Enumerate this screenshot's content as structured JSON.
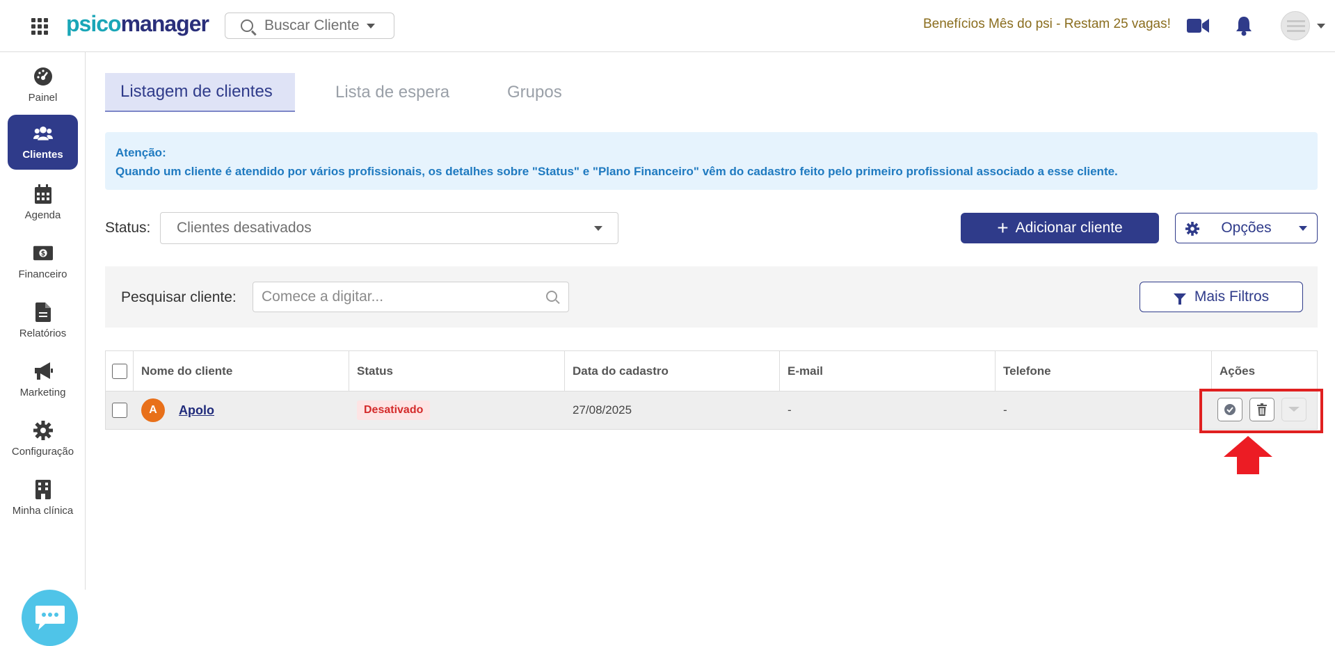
{
  "header": {
    "logo_part1": "psico",
    "logo_part2": "manager",
    "search_label": "Buscar Cliente",
    "promo_text": "Benefícios Mês do psi - Restam 25 vagas!"
  },
  "sidebar": {
    "items": [
      {
        "label": "Painel",
        "icon": "dashboard-icon"
      },
      {
        "label": "Clientes",
        "icon": "users-icon"
      },
      {
        "label": "Agenda",
        "icon": "calendar-icon"
      },
      {
        "label": "Financeiro",
        "icon": "money-icon"
      },
      {
        "label": "Relatórios",
        "icon": "document-icon"
      },
      {
        "label": "Marketing",
        "icon": "megaphone-icon"
      },
      {
        "label": "Configuração",
        "icon": "gear-icon"
      },
      {
        "label": "Minha clínica",
        "icon": "building-icon"
      }
    ],
    "active_index": 1
  },
  "tabs": [
    {
      "label": "Listagem de clientes"
    },
    {
      "label": "Lista de espera"
    },
    {
      "label": "Grupos"
    }
  ],
  "alert": {
    "title": "Atenção:",
    "message": "Quando um cliente é atendido por vários profissionais, os detalhes sobre \"Status\" e \"Plano Financeiro\" vêm do cadastro feito pelo primeiro profissional associado a esse cliente."
  },
  "status_filter": {
    "label": "Status:",
    "value": "Clientes desativados"
  },
  "buttons": {
    "add_client": "Adicionar cliente",
    "options": "Opções",
    "more_filters": "Mais Filtros"
  },
  "search": {
    "label": "Pesquisar cliente:",
    "placeholder": "Comece a digitar..."
  },
  "table": {
    "columns": [
      "Nome do cliente",
      "Status",
      "Data do cadastro",
      "E-mail",
      "Telefone",
      "Ações"
    ],
    "rows": [
      {
        "initial": "A",
        "name": "Apolo",
        "status": "Desativado",
        "date": "27/08/2025",
        "email": "-",
        "phone": "-"
      }
    ]
  },
  "colors": {
    "primary": "#2f3b8a",
    "accent_teal": "#1aa6b7",
    "alert_text": "#1f7ac0",
    "status_badge": "#d42b2b",
    "highlight": "#e02020"
  }
}
